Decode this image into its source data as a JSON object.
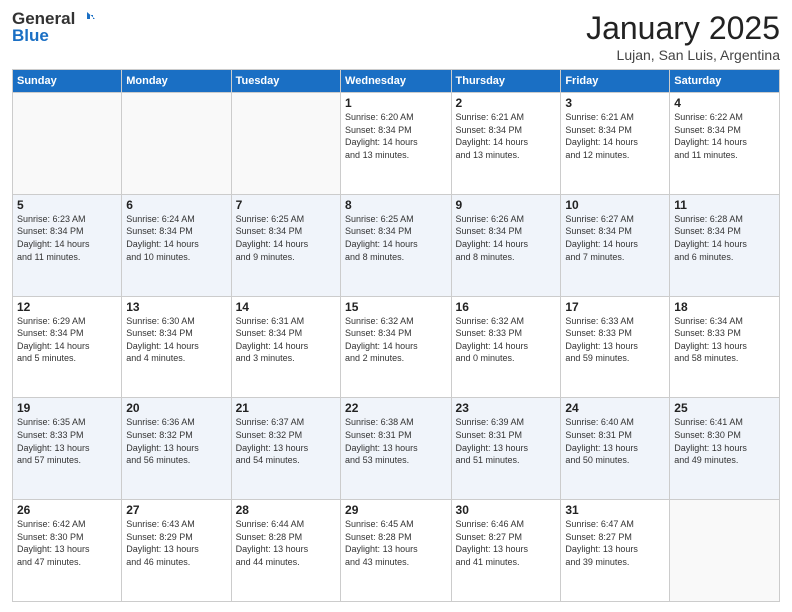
{
  "header": {
    "logo_general": "General",
    "logo_blue": "Blue",
    "month_title": "January 2025",
    "location": "Lujan, San Luis, Argentina"
  },
  "weekdays": [
    "Sunday",
    "Monday",
    "Tuesday",
    "Wednesday",
    "Thursday",
    "Friday",
    "Saturday"
  ],
  "weeks": [
    [
      {
        "day": "",
        "info": ""
      },
      {
        "day": "",
        "info": ""
      },
      {
        "day": "",
        "info": ""
      },
      {
        "day": "1",
        "info": "Sunrise: 6:20 AM\nSunset: 8:34 PM\nDaylight: 14 hours\nand 13 minutes."
      },
      {
        "day": "2",
        "info": "Sunrise: 6:21 AM\nSunset: 8:34 PM\nDaylight: 14 hours\nand 13 minutes."
      },
      {
        "day": "3",
        "info": "Sunrise: 6:21 AM\nSunset: 8:34 PM\nDaylight: 14 hours\nand 12 minutes."
      },
      {
        "day": "4",
        "info": "Sunrise: 6:22 AM\nSunset: 8:34 PM\nDaylight: 14 hours\nand 11 minutes."
      }
    ],
    [
      {
        "day": "5",
        "info": "Sunrise: 6:23 AM\nSunset: 8:34 PM\nDaylight: 14 hours\nand 11 minutes."
      },
      {
        "day": "6",
        "info": "Sunrise: 6:24 AM\nSunset: 8:34 PM\nDaylight: 14 hours\nand 10 minutes."
      },
      {
        "day": "7",
        "info": "Sunrise: 6:25 AM\nSunset: 8:34 PM\nDaylight: 14 hours\nand 9 minutes."
      },
      {
        "day": "8",
        "info": "Sunrise: 6:25 AM\nSunset: 8:34 PM\nDaylight: 14 hours\nand 8 minutes."
      },
      {
        "day": "9",
        "info": "Sunrise: 6:26 AM\nSunset: 8:34 PM\nDaylight: 14 hours\nand 8 minutes."
      },
      {
        "day": "10",
        "info": "Sunrise: 6:27 AM\nSunset: 8:34 PM\nDaylight: 14 hours\nand 7 minutes."
      },
      {
        "day": "11",
        "info": "Sunrise: 6:28 AM\nSunset: 8:34 PM\nDaylight: 14 hours\nand 6 minutes."
      }
    ],
    [
      {
        "day": "12",
        "info": "Sunrise: 6:29 AM\nSunset: 8:34 PM\nDaylight: 14 hours\nand 5 minutes."
      },
      {
        "day": "13",
        "info": "Sunrise: 6:30 AM\nSunset: 8:34 PM\nDaylight: 14 hours\nand 4 minutes."
      },
      {
        "day": "14",
        "info": "Sunrise: 6:31 AM\nSunset: 8:34 PM\nDaylight: 14 hours\nand 3 minutes."
      },
      {
        "day": "15",
        "info": "Sunrise: 6:32 AM\nSunset: 8:34 PM\nDaylight: 14 hours\nand 2 minutes."
      },
      {
        "day": "16",
        "info": "Sunrise: 6:32 AM\nSunset: 8:33 PM\nDaylight: 14 hours\nand 0 minutes."
      },
      {
        "day": "17",
        "info": "Sunrise: 6:33 AM\nSunset: 8:33 PM\nDaylight: 13 hours\nand 59 minutes."
      },
      {
        "day": "18",
        "info": "Sunrise: 6:34 AM\nSunset: 8:33 PM\nDaylight: 13 hours\nand 58 minutes."
      }
    ],
    [
      {
        "day": "19",
        "info": "Sunrise: 6:35 AM\nSunset: 8:33 PM\nDaylight: 13 hours\nand 57 minutes."
      },
      {
        "day": "20",
        "info": "Sunrise: 6:36 AM\nSunset: 8:32 PM\nDaylight: 13 hours\nand 56 minutes."
      },
      {
        "day": "21",
        "info": "Sunrise: 6:37 AM\nSunset: 8:32 PM\nDaylight: 13 hours\nand 54 minutes."
      },
      {
        "day": "22",
        "info": "Sunrise: 6:38 AM\nSunset: 8:31 PM\nDaylight: 13 hours\nand 53 minutes."
      },
      {
        "day": "23",
        "info": "Sunrise: 6:39 AM\nSunset: 8:31 PM\nDaylight: 13 hours\nand 51 minutes."
      },
      {
        "day": "24",
        "info": "Sunrise: 6:40 AM\nSunset: 8:31 PM\nDaylight: 13 hours\nand 50 minutes."
      },
      {
        "day": "25",
        "info": "Sunrise: 6:41 AM\nSunset: 8:30 PM\nDaylight: 13 hours\nand 49 minutes."
      }
    ],
    [
      {
        "day": "26",
        "info": "Sunrise: 6:42 AM\nSunset: 8:30 PM\nDaylight: 13 hours\nand 47 minutes."
      },
      {
        "day": "27",
        "info": "Sunrise: 6:43 AM\nSunset: 8:29 PM\nDaylight: 13 hours\nand 46 minutes."
      },
      {
        "day": "28",
        "info": "Sunrise: 6:44 AM\nSunset: 8:28 PM\nDaylight: 13 hours\nand 44 minutes."
      },
      {
        "day": "29",
        "info": "Sunrise: 6:45 AM\nSunset: 8:28 PM\nDaylight: 13 hours\nand 43 minutes."
      },
      {
        "day": "30",
        "info": "Sunrise: 6:46 AM\nSunset: 8:27 PM\nDaylight: 13 hours\nand 41 minutes."
      },
      {
        "day": "31",
        "info": "Sunrise: 6:47 AM\nSunset: 8:27 PM\nDaylight: 13 hours\nand 39 minutes."
      },
      {
        "day": "",
        "info": ""
      }
    ]
  ]
}
